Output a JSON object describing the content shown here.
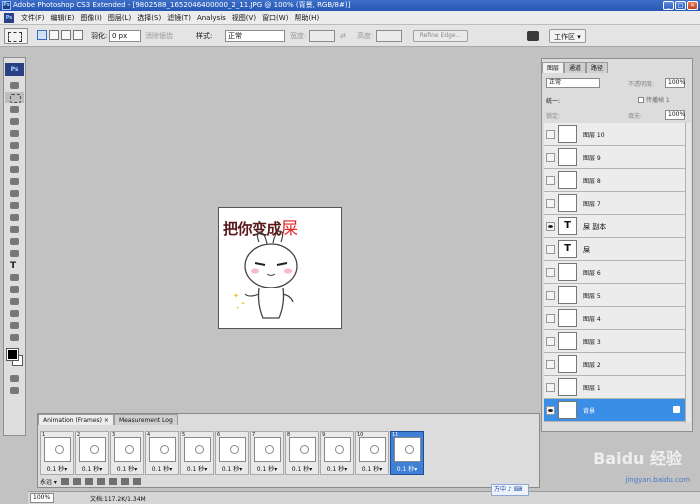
{
  "window": {
    "title": "Adobe Photoshop CS3 Extended - [9802588_1652046400000_2_11.JPG @ 100% (背景, RGB/8#)]",
    "app_icon_text": "Ps"
  },
  "menu": [
    "文件(F)",
    "编辑(E)",
    "图像(I)",
    "图层(L)",
    "选择(S)",
    "滤镜(T)",
    "Analysis",
    "视图(V)",
    "窗口(W)",
    "帮助(H)"
  ],
  "options": {
    "feather_label": "羽化:",
    "feather_value": "0 px",
    "antialias_label": "消除锯齿",
    "style_label": "样式:",
    "style_value": "正常",
    "width_label": "宽度:",
    "height_label": "高度:",
    "refine_edge": "Refine Edge...",
    "workspace": "工作区 ▾"
  },
  "tools": {
    "logo": "Ps"
  },
  "document": {
    "title_main": "把你变成",
    "title_accent": "屎"
  },
  "animation": {
    "tabs": [
      "Animation (Frames) ×",
      "Measurement Log"
    ],
    "frames": [
      {
        "num": "1",
        "delay": "0.1 秒▾"
      },
      {
        "num": "2",
        "delay": "0.1 秒▾"
      },
      {
        "num": "3",
        "delay": "0.1 秒▾"
      },
      {
        "num": "4",
        "delay": "0.1 秒▾"
      },
      {
        "num": "5",
        "delay": "0.1 秒▾"
      },
      {
        "num": "6",
        "delay": "0.1 秒▾"
      },
      {
        "num": "7",
        "delay": "0.1 秒▾"
      },
      {
        "num": "8",
        "delay": "0.1 秒▾"
      },
      {
        "num": "9",
        "delay": "0.1 秒▾"
      },
      {
        "num": "10",
        "delay": "0.1 秒▾"
      },
      {
        "num": "11",
        "delay": "0.1 秒▾"
      }
    ],
    "loop": "永远 ▾"
  },
  "layers": {
    "tabs": [
      "图层",
      "通道",
      "路径"
    ],
    "blend_mode": "正常",
    "opacity_label": "不透明度:",
    "opacity_value": "100%",
    "unify_label": "统一:",
    "propagate_label": "传播帧 1",
    "lock_label": "锁定:",
    "fill_label": "填充:",
    "fill_value": "100%",
    "items": [
      {
        "name": "图层 10",
        "visible": false,
        "type": "image"
      },
      {
        "name": "图层 9",
        "visible": false,
        "type": "image"
      },
      {
        "name": "图层 8",
        "visible": false,
        "type": "image"
      },
      {
        "name": "图层 7",
        "visible": false,
        "type": "image"
      },
      {
        "name": "屎 副本",
        "visible": true,
        "type": "text"
      },
      {
        "name": "屎",
        "visible": false,
        "type": "text"
      },
      {
        "name": "图层 6",
        "visible": false,
        "type": "image"
      },
      {
        "name": "图层 5",
        "visible": false,
        "type": "image"
      },
      {
        "name": "图层 4",
        "visible": false,
        "type": "image"
      },
      {
        "name": "图层 3",
        "visible": false,
        "type": "image"
      },
      {
        "name": "图层 2",
        "visible": false,
        "type": "image"
      },
      {
        "name": "图层 1",
        "visible": false,
        "type": "image"
      },
      {
        "name": "背景",
        "visible": true,
        "type": "image",
        "selected": true
      }
    ],
    "text_thumb": "T"
  },
  "status": {
    "zoom": "100%",
    "doc_size": "文档:117.2K/1.34M"
  },
  "overlay": {
    "ime": "万中 ♪ ⌨",
    "watermark": "Baidu 经验",
    "watermark_url": "jingyan.baidu.com"
  },
  "colors": {
    "title_bar": "#2557b5",
    "selection_blue": "#3a8ee6",
    "accent_red": "#e02020"
  }
}
